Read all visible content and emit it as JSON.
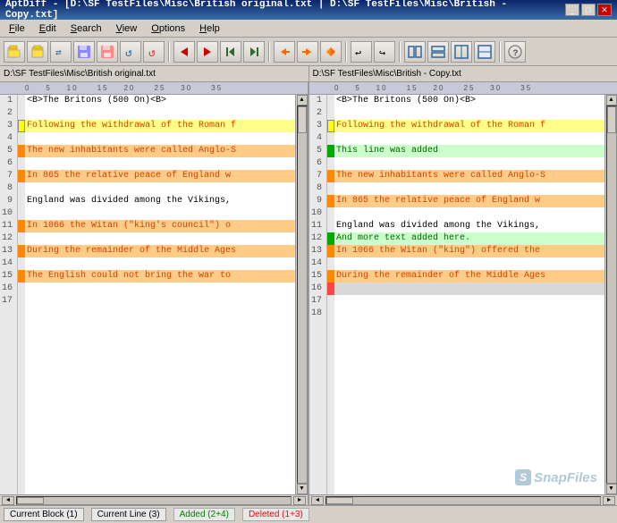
{
  "app": {
    "title": "AptDiff - [D:\\SF TestFiles\\Misc\\British original.txt | D:\\SF TestFiles\\Misc\\British - Copy.txt]",
    "title_short": "AptDiff"
  },
  "menu": {
    "items": [
      "File",
      "Edit",
      "Search",
      "View",
      "Options",
      "Help"
    ]
  },
  "toolbar": {
    "buttons": [
      "open-left",
      "open-right",
      "swap",
      "save-left",
      "save-right",
      "reload-left",
      "reload-right",
      "sep",
      "prev-diff",
      "next-diff",
      "first-diff",
      "last-diff",
      "sep2",
      "merge-left",
      "merge-right",
      "merge-all",
      "sep3",
      "undo",
      "redo",
      "sep4",
      "view1",
      "view2",
      "view3",
      "view4",
      "sep5",
      "help"
    ]
  },
  "files": {
    "left": "D:\\SF TestFiles\\Misc\\British original.txt",
    "right": "D:\\SF TestFiles\\Misc\\British - Copy.txt"
  },
  "left_panel": {
    "lines": [
      {
        "num": 1,
        "text": "<B>The Britons (500 On)<B>",
        "style": "normal"
      },
      {
        "num": 2,
        "text": "",
        "style": "normal"
      },
      {
        "num": 3,
        "text": "Following the withdrawal of the Roman f",
        "style": "current",
        "arrow": true
      },
      {
        "num": 4,
        "text": "",
        "style": "normal"
      },
      {
        "num": 5,
        "text": "The new inhabitants were called Anglo-S",
        "style": "changed"
      },
      {
        "num": 6,
        "text": "",
        "style": "normal"
      },
      {
        "num": 7,
        "text": "In 865 the relative peace of England w",
        "style": "changed"
      },
      {
        "num": 8,
        "text": "",
        "style": "normal"
      },
      {
        "num": 9,
        "text": "England was divided among the Vikings,",
        "style": "normal"
      },
      {
        "num": 10,
        "text": "",
        "style": "normal"
      },
      {
        "num": 11,
        "text": "In 1066 the Witan (\"king's council\") o",
        "style": "changed"
      },
      {
        "num": 12,
        "text": "",
        "style": "normal"
      },
      {
        "num": 13,
        "text": "During the remainder of the Middle Ages",
        "style": "changed"
      },
      {
        "num": 14,
        "text": "",
        "style": "normal"
      },
      {
        "num": 15,
        "text": "The English could not bring the war to",
        "style": "changed"
      },
      {
        "num": 16,
        "text": "",
        "style": "normal"
      },
      {
        "num": 17,
        "text": "",
        "style": "normal"
      }
    ]
  },
  "right_panel": {
    "lines": [
      {
        "num": 1,
        "text": "<B>The Britons (500 On)<B>",
        "style": "normal"
      },
      {
        "num": 2,
        "text": "",
        "style": "normal"
      },
      {
        "num": 3,
        "text": "Following the withdrawal of the Roman f",
        "style": "current"
      },
      {
        "num": 4,
        "text": "",
        "style": "normal"
      },
      {
        "num": 5,
        "text": "This line was added",
        "style": "added"
      },
      {
        "num": 6,
        "text": "",
        "style": "normal"
      },
      {
        "num": 7,
        "text": "The new inhabitants were called Anglo-S",
        "style": "changed"
      },
      {
        "num": 8,
        "text": "",
        "style": "normal"
      },
      {
        "num": 9,
        "text": "In 865 the relative peace of England w",
        "style": "changed"
      },
      {
        "num": 10,
        "text": "",
        "style": "normal"
      },
      {
        "num": 11,
        "text": "England was divided among the Vikings,",
        "style": "normal"
      },
      {
        "num": 12,
        "text": "And more text added here.",
        "style": "added"
      },
      {
        "num": 13,
        "text": "In 1066 the Witan (\"king\") offered the",
        "style": "changed"
      },
      {
        "num": 14,
        "text": "",
        "style": "normal"
      },
      {
        "num": 15,
        "text": "During the remainder of the Middle Ages",
        "style": "changed"
      },
      {
        "num": 16,
        "text": "",
        "style": "empty"
      },
      {
        "num": 17,
        "text": "",
        "style": "normal"
      },
      {
        "num": 18,
        "text": "",
        "style": "normal"
      }
    ]
  },
  "status": {
    "block": "Current Block (1)",
    "line": "Current Line (3)",
    "added": "Added (2+4)",
    "deleted": "Deleted (1+3)"
  },
  "watermark": {
    "text": "SnapFiles",
    "icon": "S"
  }
}
